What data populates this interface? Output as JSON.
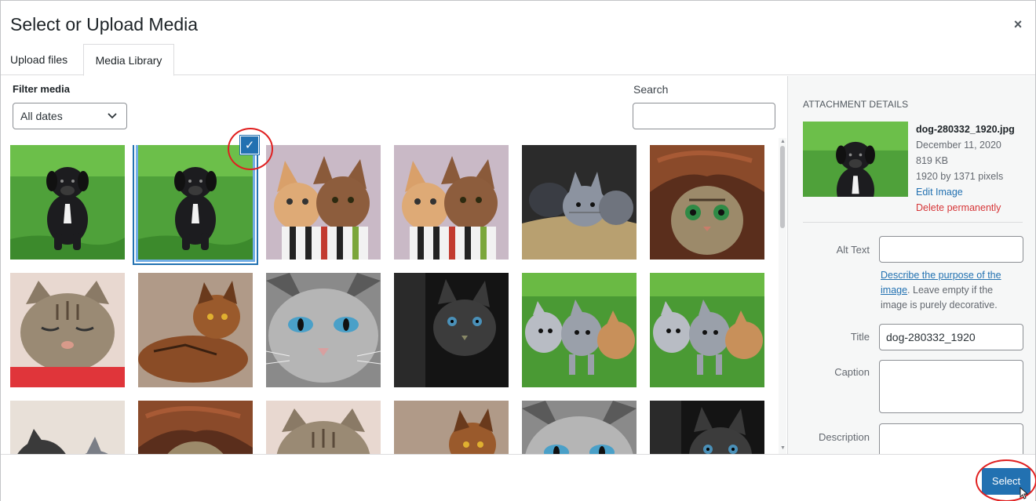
{
  "dialog": {
    "title": "Select or Upload Media",
    "close_symbol": "×"
  },
  "tabs": [
    {
      "label": "Upload files",
      "active": false
    },
    {
      "label": "Media Library",
      "active": true
    }
  ],
  "filter": {
    "label": "Filter media",
    "date_selected": "All dates"
  },
  "search": {
    "label": "Search",
    "value": ""
  },
  "media_items": [
    {
      "icon": "black-puppy-on-grass-image",
      "selected": false
    },
    {
      "icon": "black-puppy-on-grass-image",
      "selected": true
    },
    {
      "icon": "two-kittens-in-cup-image",
      "selected": false
    },
    {
      "icon": "two-kittens-in-cup-image",
      "selected": false
    },
    {
      "icon": "kittens-in-hay-image",
      "selected": false
    },
    {
      "icon": "cat-under-blanket-image",
      "selected": false
    },
    {
      "icon": "sleeping-tabby-cat-image",
      "selected": false
    },
    {
      "icon": "lying-brown-cat-image",
      "selected": false
    },
    {
      "icon": "gray-cat-closeup-image",
      "selected": false
    },
    {
      "icon": "dark-kitten-image",
      "selected": false
    },
    {
      "icon": "kittens-on-grass-image",
      "selected": false
    },
    {
      "icon": "kittens-on-grass-image",
      "selected": false
    },
    {
      "icon": "two-gray-kittens-image",
      "selected": false
    },
    {
      "icon": "cat-under-blanket-image",
      "selected": false
    },
    {
      "icon": "sleeping-tabby-cat-image",
      "selected": false
    },
    {
      "icon": "lying-brown-cat-image",
      "selected": false
    },
    {
      "icon": "gray-cat-closeup-image",
      "selected": false
    },
    {
      "icon": "dark-kitten-image",
      "selected": false
    }
  ],
  "check_symbol": "✓",
  "attachment": {
    "heading": "ATTACHMENT DETAILS",
    "filename": "dog-280332_1920.jpg",
    "date": "December 11, 2020",
    "size": "819 KB",
    "dimensions": "1920 by 1371 pixels",
    "edit_label": "Edit Image",
    "delete_label": "Delete permanently"
  },
  "fields": {
    "alt_text_label": "Alt Text",
    "alt_text_value": "",
    "alt_desc_link": "Describe the purpose of the image",
    "alt_desc_rest": ". Leave empty if the image is purely decorative.",
    "title_label": "Title",
    "title_value": "dog-280332_1920",
    "caption_label": "Caption",
    "caption_value": "",
    "description_label": "Description",
    "description_value": ""
  },
  "footer": {
    "select_label": "Select"
  },
  "colors": {
    "accent": "#2271b1",
    "delete": "#d63638",
    "highlight_circle": "#e02020"
  }
}
